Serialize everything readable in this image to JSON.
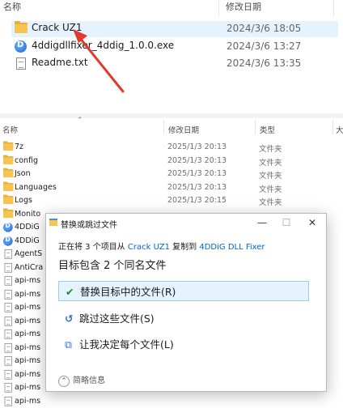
{
  "top_explorer": {
    "columns": {
      "name": "名称",
      "date": "修改日期"
    },
    "files": [
      {
        "name": "Crack UZ1",
        "date": "2024/3/6 18:05",
        "icon": "folder-icon"
      },
      {
        "name": "4ddigdllfixer_4ddig_1.0.0.exe",
        "date": "2024/3/6 13:27",
        "icon": "app-icon"
      },
      {
        "name": "Readme.txt",
        "date": "2024/3/6 13:35",
        "icon": "text-file-icon"
      }
    ]
  },
  "bottom_explorer": {
    "columns": {
      "name": "名称",
      "date": "修改日期",
      "type": "类型",
      "size": "大"
    },
    "files": [
      {
        "name": "7z",
        "date": "2025/1/3 20:13",
        "type": "文件夹",
        "icon": "folder-icon"
      },
      {
        "name": "config",
        "date": "2025/1/3 20:13",
        "type": "文件夹",
        "icon": "folder-icon"
      },
      {
        "name": "Json",
        "date": "2025/1/3 20:13",
        "type": "文件夹",
        "icon": "folder-icon"
      },
      {
        "name": "Languages",
        "date": "2025/1/3 20:13",
        "type": "文件夹",
        "icon": "folder-icon"
      },
      {
        "name": "Logs",
        "date": "2025/1/3 20:15",
        "type": "文件夹",
        "icon": "folder-icon"
      },
      {
        "name": "Monito",
        "date": "",
        "type": "",
        "icon": "folder-icon"
      },
      {
        "name": "4DDiG",
        "date": "",
        "type": "",
        "icon": "app-icon"
      },
      {
        "name": "4DDiG",
        "date": "",
        "type": "",
        "icon": "app-icon"
      },
      {
        "name": "AgentS",
        "date": "",
        "type": "",
        "icon": "file-icon"
      },
      {
        "name": "AntiCra",
        "date": "",
        "type": "",
        "icon": "file-icon"
      },
      {
        "name": "api-ms",
        "date": "",
        "type": "",
        "icon": "file-icon"
      },
      {
        "name": "api-ms",
        "date": "",
        "type": "",
        "icon": "file-icon"
      },
      {
        "name": "api-ms",
        "date": "",
        "type": "",
        "icon": "file-icon"
      },
      {
        "name": "api-ms",
        "date": "",
        "type": "",
        "icon": "file-icon"
      },
      {
        "name": "api-ms",
        "date": "",
        "type": "",
        "icon": "file-icon"
      },
      {
        "name": "api-ms",
        "date": "",
        "type": "",
        "icon": "file-icon"
      },
      {
        "name": "api-ms",
        "date": "",
        "type": "",
        "icon": "file-icon"
      },
      {
        "name": "api-ms",
        "date": "",
        "type": "",
        "icon": "file-icon"
      },
      {
        "name": "api-ms",
        "date": "",
        "type": "",
        "icon": "file-icon"
      },
      {
        "name": "api-ms",
        "date": "",
        "type": "",
        "icon": "file-icon"
      }
    ]
  },
  "dialog": {
    "title": "替换或跳过文件",
    "progress_prefix": "正在将 3 个项目从",
    "source": "Crack UZ1",
    "progress_middle": "复制到",
    "destination": "4DDiG DLL Fixer",
    "heading": "目标包含 2 个同名文件",
    "options": [
      {
        "label": "替换目标中的文件(R)",
        "icon": "check-icon",
        "selected": true
      },
      {
        "label": "跳过这些文件(S)",
        "icon": "skip-icon",
        "selected": false
      },
      {
        "label": "让我决定每个文件(L)",
        "icon": "decide-icon",
        "selected": false
      }
    ],
    "details_label": "简略信息",
    "controls": {
      "minimize": "—",
      "maximize": "☐",
      "close": "✕"
    }
  },
  "colors": {
    "annotation_arrow": "#e03a2e",
    "link": "#0066cc",
    "selection": "#e5f3ff"
  }
}
